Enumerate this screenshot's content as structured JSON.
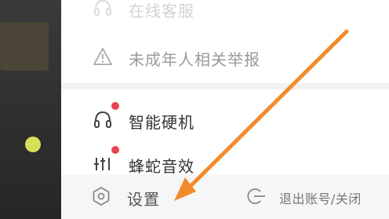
{
  "menu": {
    "items": [
      {
        "label": "在线客服",
        "icon": "headset-icon",
        "partial": true
      },
      {
        "label": "未成年人相关举报",
        "icon": "warning-icon"
      },
      {
        "label": "智能硬机",
        "icon": "headphones-icon",
        "badge": true
      },
      {
        "label": "蜂蛇音效",
        "icon": "equalizer-icon",
        "badge": true
      }
    ]
  },
  "footer": {
    "settings_label": "设置",
    "logout_label": "退出账号/关闭"
  },
  "colors": {
    "badge": "#e8434f",
    "annotation_arrow": "#f28b2e"
  }
}
